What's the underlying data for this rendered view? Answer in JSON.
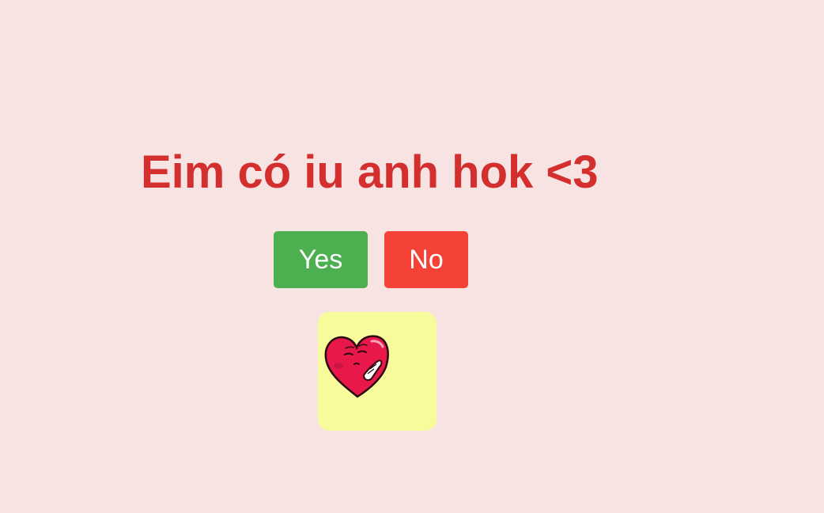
{
  "question": {
    "text": "Eim có iu anh hok <3",
    "color": "#d32f2f"
  },
  "buttons": {
    "yes": {
      "label": "Yes",
      "color": "#4caf50"
    },
    "no": {
      "label": "No",
      "color": "#f44336"
    }
  },
  "sticker": {
    "icon": "blushing-heart-icon",
    "background": "#f8fb9c",
    "heart_color": "#e8194a"
  }
}
